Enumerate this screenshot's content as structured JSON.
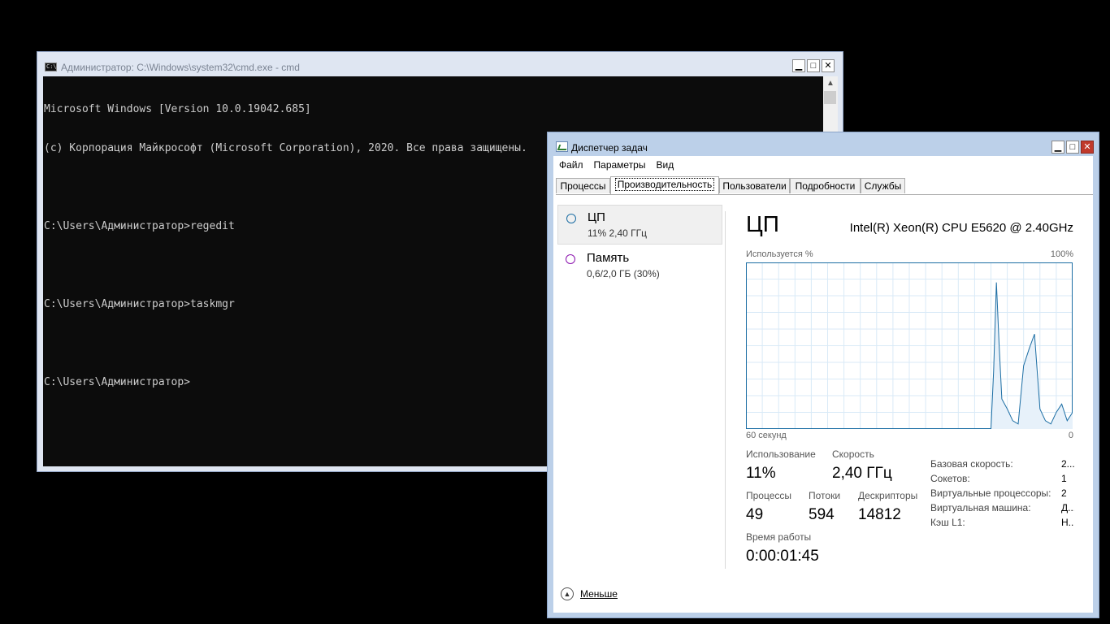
{
  "cmd": {
    "title": "Администратор: C:\\Windows\\system32\\cmd.exe - cmd",
    "icon": "console-icon",
    "lines": [
      "Microsoft Windows [Version 10.0.19042.685]",
      "(c) Корпорация Майкрософт (Microsoft Corporation), 2020. Все права защищены.",
      "",
      "C:\\Users\\Администратор>regedit",
      "",
      "C:\\Users\\Администратор>taskmgr",
      "",
      "C:\\Users\\Администратор>"
    ]
  },
  "taskmgr": {
    "title": "Диспетчер задач",
    "menu": [
      "Файл",
      "Параметры",
      "Вид"
    ],
    "tabs": [
      {
        "label": "Процессы",
        "active": false
      },
      {
        "label": "Производительность",
        "active": true
      },
      {
        "label": "Пользователи",
        "active": false
      },
      {
        "label": "Подробности",
        "active": false
      },
      {
        "label": "Службы",
        "active": false
      }
    ],
    "nav": [
      {
        "label": "ЦП",
        "sub": "11%  2,40 ГГц",
        "color": "#1c6ea4",
        "selected": true
      },
      {
        "label": "Память",
        "sub": "0,6/2,0 ГБ (30%)",
        "color": "#8b12ae",
        "selected": false
      }
    ],
    "perf": {
      "heading": "ЦП",
      "cpu_name": "Intel(R) Xeon(R) CPU E5620 @ 2.40GHz",
      "y_label": "Используется %",
      "y_max": "100%",
      "x_label": "60 секунд",
      "x_min": "0",
      "utilization_label": "Использование",
      "utilization_value": "11%",
      "speed_label": "Скорость",
      "speed_value": "2,40 ГГц",
      "processes_label": "Процессы",
      "processes_value": "49",
      "threads_label": "Потоки",
      "threads_value": "594",
      "handles_label": "Дескрипторы",
      "handles_value": "14812",
      "uptime_label": "Время работы",
      "uptime_value": "0:00:01:45",
      "properties": [
        {
          "key": "Базовая скорость:",
          "value": "2..."
        },
        {
          "key": "Сокетов:",
          "value": "1"
        },
        {
          "key": "Виртуальные процессоры:",
          "value": "2"
        },
        {
          "key": "Виртуальная машина:",
          "value": "Д..."
        },
        {
          "key": "Кэш L1:",
          "value": "Н..."
        }
      ]
    },
    "fewer_details": "Меньше",
    "chart_data": {
      "type": "area",
      "y_label": "Используется %",
      "x_label": "60 секунд",
      "ylim": [
        0,
        100
      ],
      "xlim": [
        60,
        0
      ],
      "x": [
        60,
        55,
        50,
        45,
        40,
        35,
        30,
        25,
        20,
        17,
        16,
        15,
        14.5,
        14,
        13.5,
        13,
        12,
        11,
        10,
        9,
        8,
        7,
        6,
        5,
        4,
        3,
        2,
        1,
        0
      ],
      "values": [
        0,
        0,
        0,
        0,
        0,
        0,
        0,
        0,
        0,
        0,
        0,
        0,
        35,
        88,
        50,
        18,
        12,
        5,
        3,
        38,
        48,
        57,
        12,
        5,
        3,
        10,
        15,
        5,
        10
      ],
      "color": "#1c6ea4",
      "grid": true
    }
  }
}
